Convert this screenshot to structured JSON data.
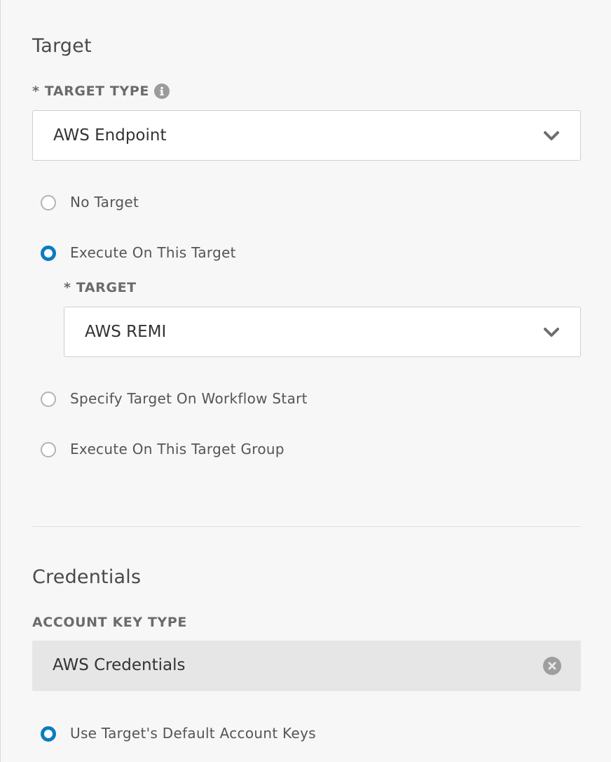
{
  "target_section": {
    "title": "Target",
    "target_type": {
      "label": "* TARGET TYPE",
      "info_icon": "info-icon",
      "value": "AWS Endpoint"
    },
    "options": [
      {
        "label": "No Target",
        "checked": false
      },
      {
        "label": "Execute On This Target",
        "checked": true
      },
      {
        "label": "Specify Target On Workflow Start",
        "checked": false
      },
      {
        "label": "Execute On This Target Group",
        "checked": false
      }
    ],
    "target": {
      "label": "* TARGET",
      "value": "AWS REMI"
    }
  },
  "credentials_section": {
    "title": "Credentials",
    "account_key_type": {
      "label": "ACCOUNT KEY TYPE",
      "value": "AWS Credentials",
      "clear_icon": "clear-icon"
    },
    "options": [
      {
        "label": "Use Target's Default Account Keys",
        "checked": true
      }
    ]
  },
  "colors": {
    "accent": "#0a7bc2",
    "background": "#f7f7f7"
  }
}
